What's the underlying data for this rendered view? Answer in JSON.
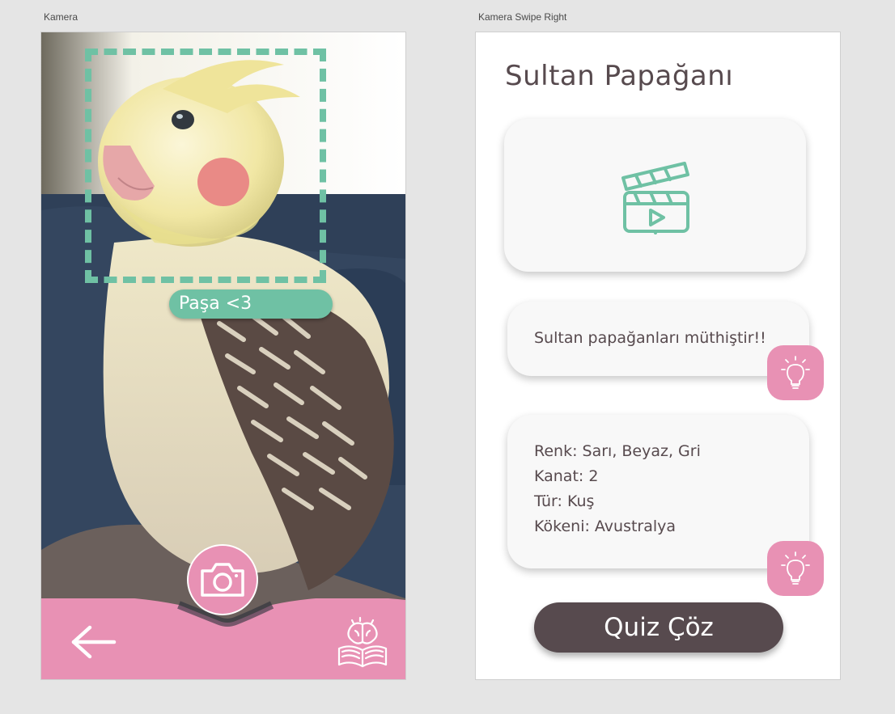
{
  "artboards": {
    "camera_label": "Kamera",
    "info_label": "Kamera Swipe Right"
  },
  "camera": {
    "detected_label": "Paşa <3",
    "icons": {
      "shutter": "camera-icon",
      "back": "arrow-left-icon",
      "learn": "brain-book-icon"
    }
  },
  "info": {
    "title": "Sultan Papağanı",
    "video_icon": "clapperboard-play-icon",
    "fact": "Sultan papağanları müthiştir!!",
    "attributes": [
      "Renk: Sarı, Beyaz, Gri",
      "Kanat: 2",
      "Tür: Kuş",
      "Kökeni: Avustralya"
    ],
    "hint_icon": "lightbulb-icon",
    "quiz_button": "Quiz Çöz"
  },
  "colors": {
    "accent_green": "#6fc1a4",
    "accent_pink": "#e891b4",
    "dark": "#574a4e",
    "card_bg": "#f8f8f8"
  }
}
